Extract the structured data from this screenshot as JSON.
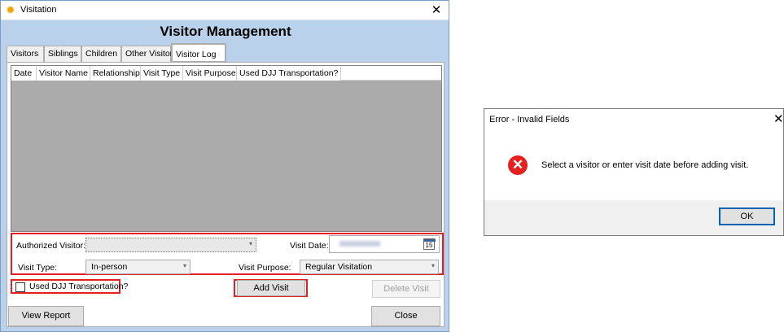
{
  "window": {
    "title": "Visitation",
    "heading": "Visitor Management",
    "close_glyph": "✕",
    "icon": "sun-icon"
  },
  "tabs": [
    {
      "label": "Visitors"
    },
    {
      "label": "Siblings"
    },
    {
      "label": "Children"
    },
    {
      "label": "Other Visitors"
    },
    {
      "label": "Visitor Log",
      "selected": true
    }
  ],
  "grid": {
    "columns": [
      "Date",
      "Visitor Name",
      "Relationship",
      "Visit Type",
      "Visit Purpose",
      "Used DJJ Transportation?"
    ],
    "rows": []
  },
  "form": {
    "authorized_visitor_label": "Authorized Visitor:",
    "authorized_visitor_value": "",
    "visit_date_label": "Visit Date:",
    "visit_date_value": "",
    "calendar_day": "15",
    "visit_type_label": "Visit Type:",
    "visit_type_value": "In-person",
    "visit_purpose_label": "Visit Purpose:",
    "visit_purpose_value": "Regular Visitation",
    "used_djj_label": "Used DJJ Transportation?",
    "used_djj_checked": false
  },
  "buttons": {
    "add_visit": "Add Visit",
    "delete_visit": "Delete Visit",
    "view_report": "View Report",
    "close": "Close"
  },
  "dialog": {
    "title": "Error - Invalid Fields",
    "close_glyph": "✕",
    "icon": "error-icon",
    "message": "Select a visitor or enter visit date before adding visit.",
    "ok": "OK"
  },
  "highlight_color": "#e21f26"
}
